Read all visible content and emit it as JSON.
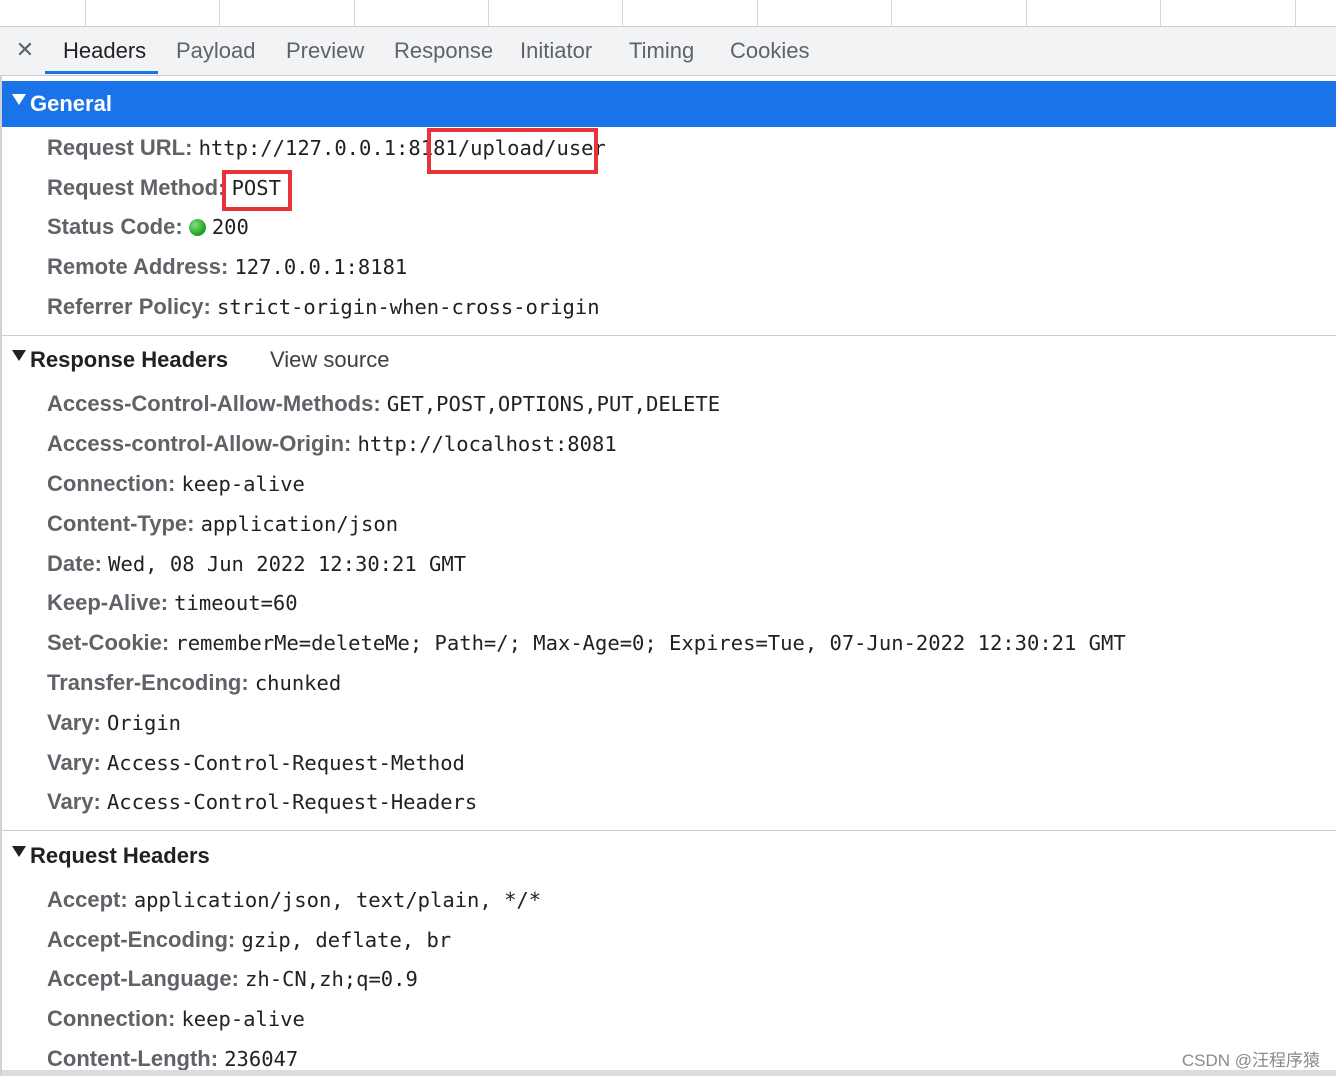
{
  "tabs": {
    "close_label": "✕",
    "items": [
      "Headers",
      "Payload",
      "Preview",
      "Response",
      "Initiator",
      "Timing",
      "Cookies"
    ],
    "active": "Headers"
  },
  "general": {
    "title": "General",
    "rows": [
      {
        "key": "Request URL:",
        "value": "http://127.0.0.1:8181/upload/user"
      },
      {
        "key": "Request Method:",
        "value": "POST"
      },
      {
        "key": "Status Code:",
        "value": "200"
      },
      {
        "key": "Remote Address:",
        "value": "127.0.0.1:8181"
      },
      {
        "key": "Referrer Policy:",
        "value": "strict-origin-when-cross-origin"
      }
    ]
  },
  "response_headers": {
    "title": "Response Headers",
    "view_source": "View source",
    "rows": [
      {
        "key": "Access-Control-Allow-Methods:",
        "value": "GET,POST,OPTIONS,PUT,DELETE"
      },
      {
        "key": "Access-control-Allow-Origin:",
        "value": "http://localhost:8081"
      },
      {
        "key": "Connection:",
        "value": "keep-alive"
      },
      {
        "key": "Content-Type:",
        "value": "application/json"
      },
      {
        "key": "Date:",
        "value": "Wed, 08 Jun 2022 12:30:21 GMT"
      },
      {
        "key": "Keep-Alive:",
        "value": "timeout=60"
      },
      {
        "key": "Set-Cookie:",
        "value": "rememberMe=deleteMe; Path=/; Max-Age=0; Expires=Tue, 07-Jun-2022 12:30:21 GMT"
      },
      {
        "key": "Transfer-Encoding:",
        "value": "chunked"
      },
      {
        "key": "Vary:",
        "value": "Origin"
      },
      {
        "key": "Vary:",
        "value": "Access-Control-Request-Method"
      },
      {
        "key": "Vary:",
        "value": "Access-Control-Request-Headers"
      }
    ]
  },
  "request_headers": {
    "title": "Request Headers",
    "rows": [
      {
        "key": "Accept:",
        "value": "application/json, text/plain, */*"
      },
      {
        "key": "Accept-Encoding:",
        "value": "gzip, deflate, br"
      },
      {
        "key": "Accept-Language:",
        "value": "zh-CN,zh;q=0.9"
      },
      {
        "key": "Connection:",
        "value": "keep-alive"
      },
      {
        "key": "Content-Length:",
        "value": "236047"
      }
    ]
  },
  "watermark": "CSDN @汪程序猿",
  "colors": {
    "accent": "#1a73e8",
    "highlight": "#e8333a",
    "status_ok": "#1e9e1e"
  },
  "icons": {
    "close": "close-icon",
    "section_toggle": "triangle-down-icon",
    "status": "status-dot-icon"
  }
}
